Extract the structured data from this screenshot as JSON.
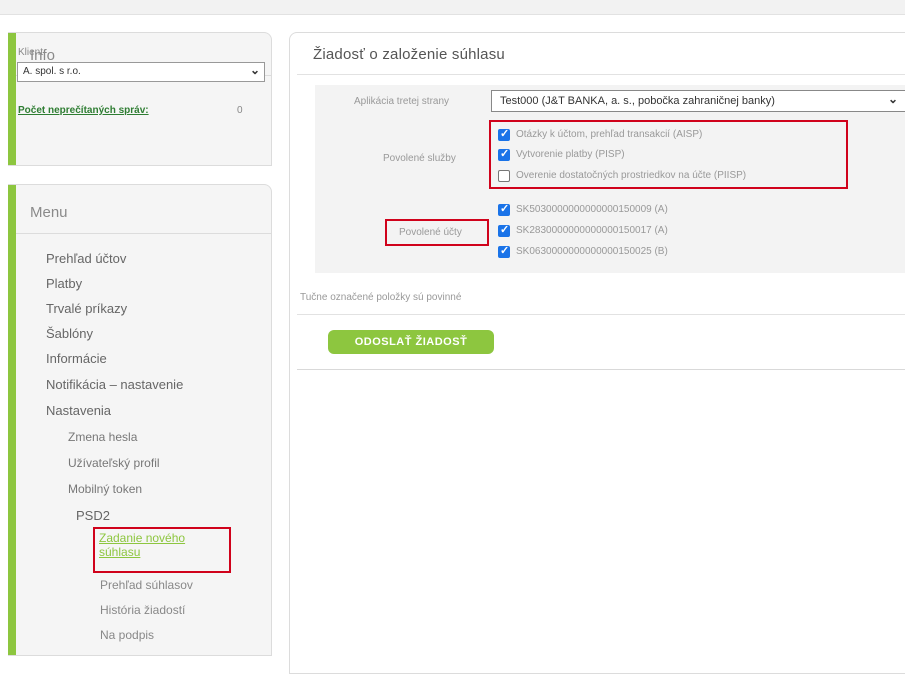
{
  "info": {
    "title": "Info",
    "client_label": "Klient:",
    "client_value": "A. spol. s r.o.",
    "unread_label": "Počet neprečítaných správ:",
    "unread_count": "0"
  },
  "menu": {
    "title": "Menu",
    "items": [
      "Prehľad účtov",
      "Platby",
      "Trvalé príkazy",
      "Šablóny",
      "Informácie",
      "Notifikácia – nastavenie",
      "Nastavenia"
    ],
    "settings_items": [
      "Zmena hesla",
      "Užívateľský profil",
      "Mobilný token"
    ],
    "psd2": "PSD2",
    "psd2_items": {
      "active": "Zadanie nového súhlasu",
      "others": [
        "Prehľad súhlasov",
        "História žiadostí",
        "Na podpis"
      ]
    }
  },
  "main": {
    "title": "Žiadosť o založenie súhlasu",
    "app_label": "Aplikácia tretej strany",
    "app_value": "Test000 (J&T BANKA, a. s., pobočka zahraničnej banky)",
    "services_label": "Povolené služby",
    "services": [
      {
        "label": "Otázky k účtom, prehľad transakcií (AISP)",
        "checked": true
      },
      {
        "label": "Vytvorenie platby (PISP)",
        "checked": true
      },
      {
        "label": "Overenie dostatočných prostriedkov na účte (PIISP)",
        "checked": false
      }
    ],
    "accounts_label": "Povolené účty",
    "accounts": [
      {
        "label": "SK5030000000000000150009 (A)",
        "checked": true
      },
      {
        "label": "SK2830000000000000150017 (A)",
        "checked": true
      },
      {
        "label": "SK0630000000000000150025 (B)",
        "checked": true
      }
    ],
    "required_note": "Tučne označené položky sú povinné",
    "submit_label": "ODOSLAŤ ŽIADOSŤ"
  },
  "colors": {
    "accent": "#8dc63f",
    "highlight": "#d0021b",
    "checkbox": "#1a73e8"
  }
}
